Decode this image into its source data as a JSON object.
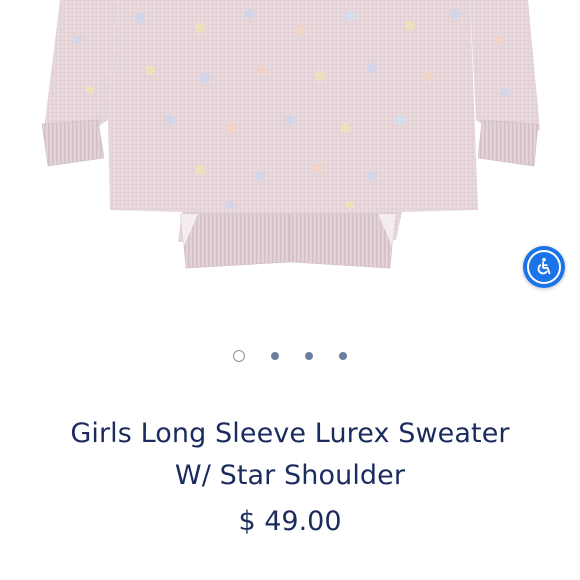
{
  "product": {
    "title_line1": "Girls Long Sleeve Lurex Sweater",
    "title_line2": "W/ Star Shoulder",
    "price": "$ 49.00"
  },
  "carousel": {
    "dot_count": 4,
    "active_index": 0
  },
  "accessibility": {
    "icon": "wheelchair-icon"
  },
  "colors": {
    "text_navy": "#1b2b5e",
    "accessibility_blue": "#1a73e8",
    "sweater_base": "#e8d8dc"
  }
}
